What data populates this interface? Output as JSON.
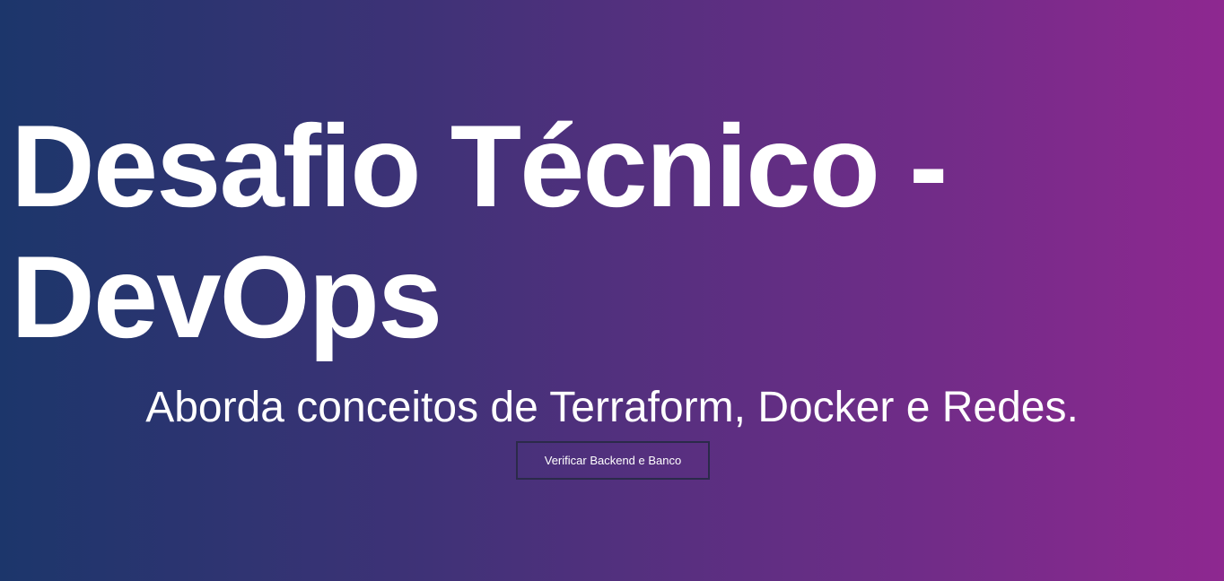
{
  "hero": {
    "title": "Desafio Técnico - DevOps",
    "subtitle": "Aborda conceitos de Terraform, Docker e Redes.",
    "button_label": "Verificar Backend e Banco"
  },
  "colors": {
    "gradient_start": "#1c366b",
    "gradient_end": "#8e2890",
    "text": "#ffffff",
    "button_border": "#2b2a4a"
  }
}
